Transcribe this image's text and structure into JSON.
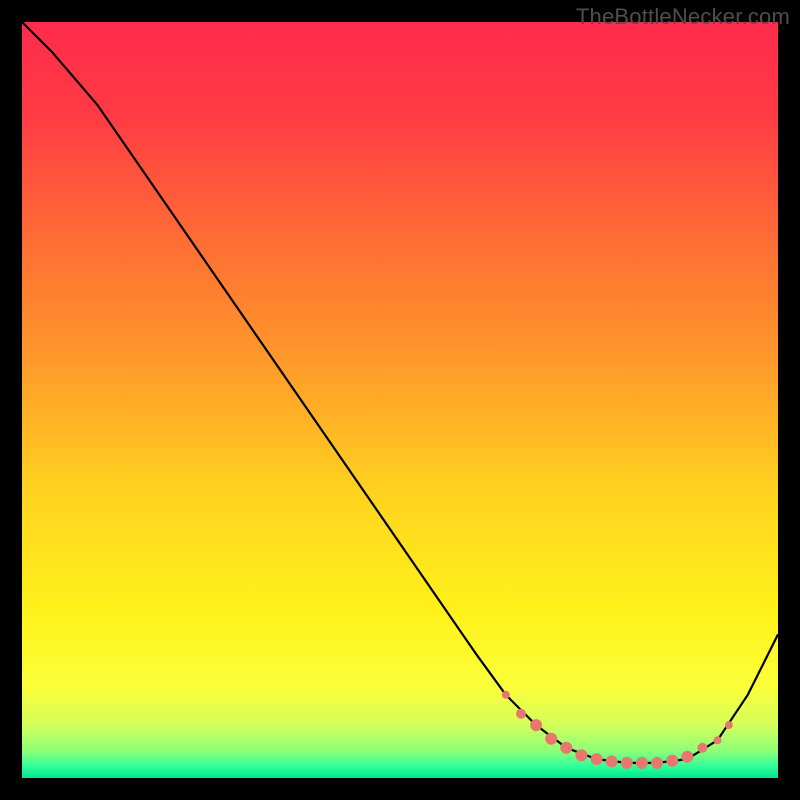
{
  "watermark": "TheBottleNecker.com",
  "colors": {
    "black": "#000000",
    "line": "#000000",
    "marker": "#e8776d",
    "gradient_stops": [
      {
        "offset": 0.0,
        "color": "#ff2b4c"
      },
      {
        "offset": 0.12,
        "color": "#ff3a44"
      },
      {
        "offset": 0.28,
        "color": "#ff6a35"
      },
      {
        "offset": 0.45,
        "color": "#ff9a2a"
      },
      {
        "offset": 0.62,
        "color": "#ffd21f"
      },
      {
        "offset": 0.78,
        "color": "#fff21a"
      },
      {
        "offset": 0.88,
        "color": "#faff3a"
      },
      {
        "offset": 0.93,
        "color": "#d4ff5a"
      },
      {
        "offset": 0.965,
        "color": "#8cff7a"
      },
      {
        "offset": 0.985,
        "color": "#2fff9a"
      },
      {
        "offset": 1.0,
        "color": "#00e58f"
      }
    ]
  },
  "chart_data": {
    "type": "line",
    "title": "",
    "xlabel": "",
    "ylabel": "",
    "xlim": [
      0,
      100
    ],
    "ylim": [
      0,
      100
    ],
    "grid": false,
    "legend": false,
    "series": [
      {
        "name": "curve",
        "x": [
          0,
          4,
          7,
          10,
          20,
          30,
          40,
          50,
          60,
          64,
          68,
          72,
          76,
          80,
          84,
          88,
          92,
          96,
          100
        ],
        "y": [
          100,
          96,
          92.5,
          89,
          74.5,
          60,
          45.5,
          31,
          16.5,
          11,
          7,
          4,
          2.5,
          2,
          2,
          2.5,
          5,
          11,
          19
        ]
      }
    ],
    "markers": [
      {
        "x": 64,
        "y": 11,
        "r": 4
      },
      {
        "x": 66,
        "y": 8.5,
        "r": 5
      },
      {
        "x": 68,
        "y": 7,
        "r": 6
      },
      {
        "x": 70,
        "y": 5.2,
        "r": 6
      },
      {
        "x": 72,
        "y": 4,
        "r": 6
      },
      {
        "x": 74,
        "y": 3,
        "r": 6
      },
      {
        "x": 76,
        "y": 2.5,
        "r": 6
      },
      {
        "x": 78,
        "y": 2.2,
        "r": 6
      },
      {
        "x": 80,
        "y": 2,
        "r": 6
      },
      {
        "x": 82,
        "y": 2,
        "r": 6
      },
      {
        "x": 84,
        "y": 2,
        "r": 6
      },
      {
        "x": 86,
        "y": 2.3,
        "r": 6
      },
      {
        "x": 88,
        "y": 2.8,
        "r": 6
      },
      {
        "x": 90,
        "y": 4,
        "r": 5
      },
      {
        "x": 92,
        "y": 5,
        "r": 4
      },
      {
        "x": 93.5,
        "y": 7,
        "r": 4
      }
    ]
  }
}
